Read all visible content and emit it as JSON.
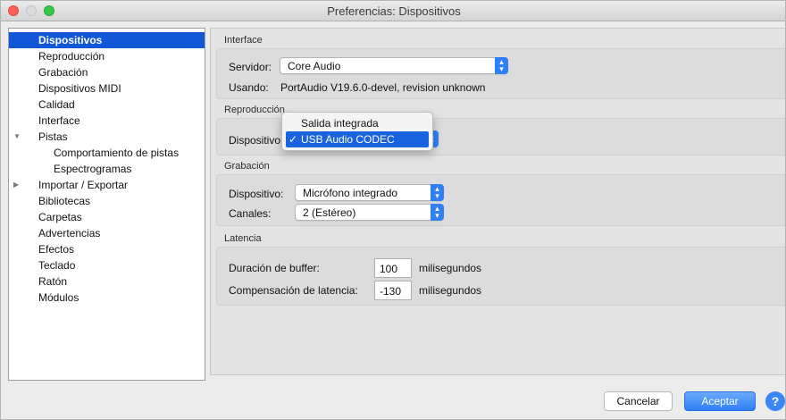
{
  "window": {
    "title": "Preferencias: Dispositivos"
  },
  "sidebar": {
    "items": [
      {
        "label": "Dispositivos",
        "selected": true
      },
      {
        "label": "Reproducción"
      },
      {
        "label": "Grabación"
      },
      {
        "label": "Dispositivos MIDI"
      },
      {
        "label": "Calidad"
      },
      {
        "label": "Interface"
      },
      {
        "label": "Pistas",
        "expanded": true
      },
      {
        "label": "Comportamiento de pistas"
      },
      {
        "label": "Espectrogramas"
      },
      {
        "label": "Importar / Exportar",
        "expanded": false
      },
      {
        "label": "Bibliotecas"
      },
      {
        "label": "Carpetas"
      },
      {
        "label": "Advertencias"
      },
      {
        "label": "Efectos"
      },
      {
        "label": "Teclado"
      },
      {
        "label": "Ratón"
      },
      {
        "label": "Módulos"
      }
    ]
  },
  "interface_group": {
    "title": "Interface",
    "server_label": "Servidor:",
    "server_value": "Core Audio",
    "using_label": "Usando:",
    "using_value": "PortAudio V19.6.0-devel, revision unknown"
  },
  "playback_group": {
    "title": "Reproducción",
    "device_label": "Dispositivo:",
    "device_value": "USB Audio CODEC",
    "menu_options": [
      "Salida integrada",
      "USB Audio CODEC"
    ],
    "check_mark": "✓"
  },
  "recording_group": {
    "title": "Grabación",
    "device_label": "Dispositivo:",
    "device_value": "Micrófono integrado",
    "channels_label": "Canales:",
    "channels_value": "2 (Estéreo)"
  },
  "latency_group": {
    "title": "Latencia",
    "buffer_label": "Duración de buffer:",
    "buffer_value": "100",
    "buffer_unit": "milisegundos",
    "compensation_label": "Compensación de latencia:",
    "compensation_value": "-130",
    "compensation_unit": "milisegundos"
  },
  "footer": {
    "cancel_label": "Cancelar",
    "ok_label": "Aceptar",
    "help_label": "?"
  },
  "colors": {
    "selection": "#1258d6",
    "accent": "#2f7ff6"
  }
}
